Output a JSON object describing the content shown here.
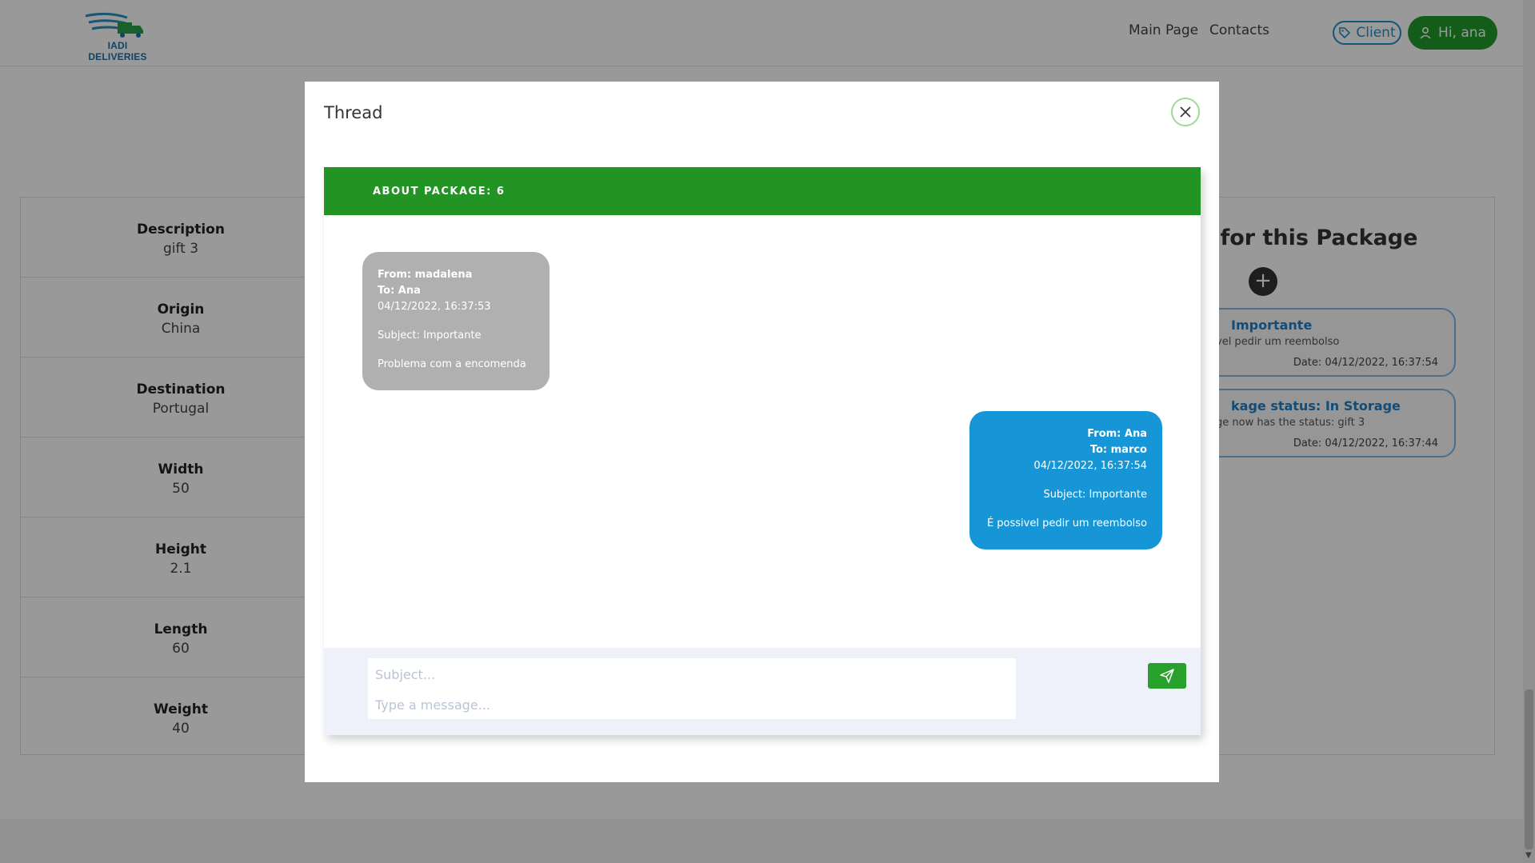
{
  "navbar": {
    "logo_text": "IADI DELIVERIES",
    "links": [
      "Main Page",
      "Contacts"
    ],
    "role_label": "Client",
    "user_label": "Hi, ana"
  },
  "details": [
    {
      "label": "Description",
      "value": "gift 3"
    },
    {
      "label": "Origin",
      "value": "China"
    },
    {
      "label": "Destination",
      "value": "Portugal"
    },
    {
      "label": "Width",
      "value": "50"
    },
    {
      "label": "Height",
      "value": "2.1"
    },
    {
      "label": "Length",
      "value": "60"
    },
    {
      "label": "Weight",
      "value": "40"
    }
  ],
  "notifications": {
    "title": "s for this Package",
    "items": [
      {
        "title": "Importante",
        "body": "vel pedir um reembolso",
        "date": "Date: 04/12/2022, 16:37:54"
      },
      {
        "title": "kage status: In Storage",
        "body": "ge now has the status: gift 3",
        "date": "Date: 04/12/2022, 16:37:44"
      }
    ]
  },
  "modal": {
    "title": "Thread",
    "header": "ABOUT PACKAGE: 6",
    "messages": [
      {
        "from": "From: madalena",
        "to": "To: Ana",
        "date": "04/12/2022, 16:37:53",
        "subject": "Subject: Importante",
        "text": "Problema com a encomenda"
      },
      {
        "from": "From: Ana",
        "to": "To: marco",
        "date": "04/12/2022, 16:37:54",
        "subject": "Subject: Importante",
        "text": "É possivel pedir um reembolso"
      }
    ],
    "composer": {
      "subject_placeholder": "Subject...",
      "message_placeholder": "Type a message..."
    }
  },
  "colors": {
    "brand_green": "#229a2a",
    "header_green": "#229424",
    "bubble_gray": "#b0b0b0",
    "bubble_blue": "#1696d6",
    "accent_blue": "#1e8fc8"
  }
}
